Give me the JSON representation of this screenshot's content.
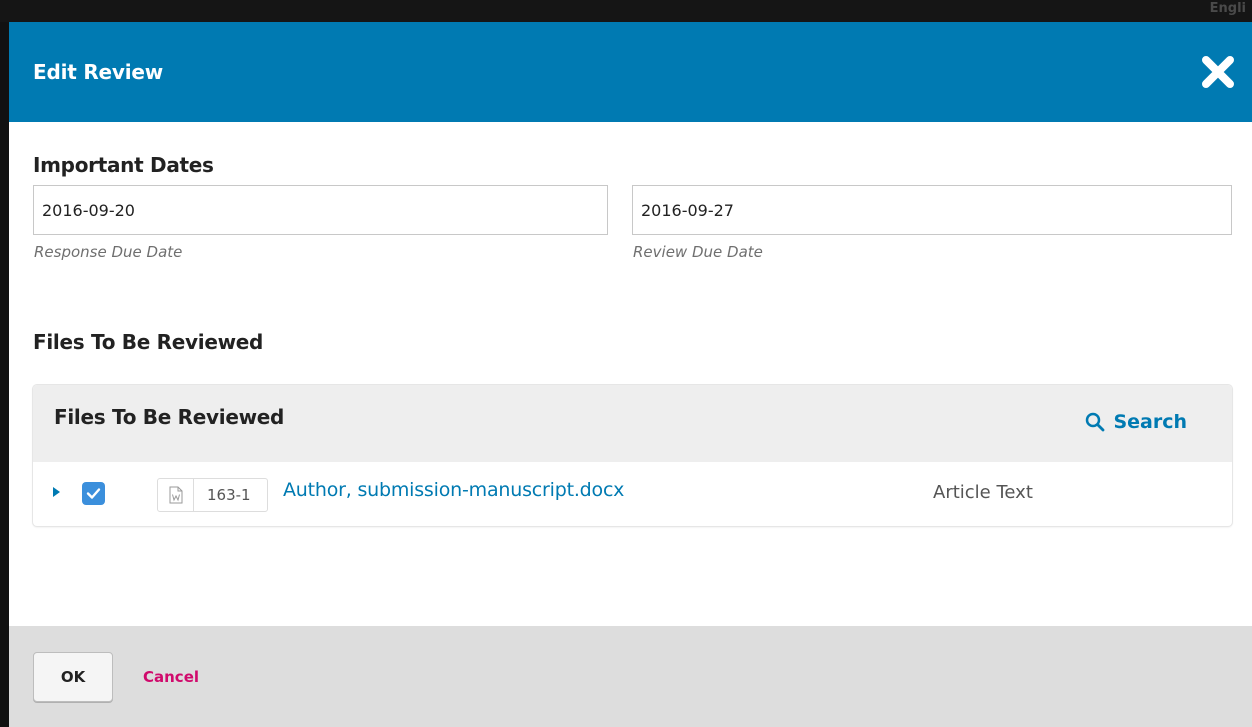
{
  "backdrop": {
    "language_label": "Engli"
  },
  "modal": {
    "title": "Edit Review",
    "close_icon": "close-icon",
    "header_color": "#007ab2"
  },
  "important_dates": {
    "heading": "Important Dates",
    "response_due": {
      "value": "2016-09-20",
      "description": "Response Due Date"
    },
    "review_due": {
      "value": "2016-09-27",
      "description": "Review Due Date"
    }
  },
  "files": {
    "section_heading": "Files To Be Reviewed",
    "grid_title": "Files To Be Reviewed",
    "search_label": "Search",
    "search_icon": "search-icon",
    "rows": [
      {
        "checked": true,
        "file_icon": "word-document-icon",
        "file_id": "163-1",
        "file_name": "Author, submission-manuscript.docx",
        "file_type": "Article Text"
      }
    ]
  },
  "footer": {
    "ok_label": "OK",
    "cancel_label": "Cancel",
    "cancel_color": "#d00a6c"
  }
}
